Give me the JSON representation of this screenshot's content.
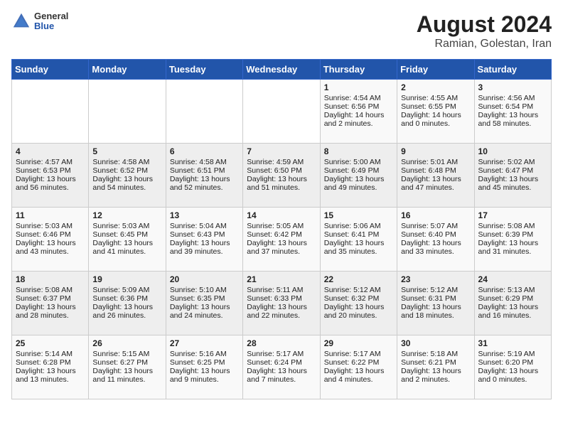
{
  "logo": {
    "general": "General",
    "blue": "Blue"
  },
  "title": "August 2024",
  "subtitle": "Ramian, Golestan, Iran",
  "days_of_week": [
    "Sunday",
    "Monday",
    "Tuesday",
    "Wednesday",
    "Thursday",
    "Friday",
    "Saturday"
  ],
  "weeks": [
    [
      {
        "day": "",
        "info": ""
      },
      {
        "day": "",
        "info": ""
      },
      {
        "day": "",
        "info": ""
      },
      {
        "day": "",
        "info": ""
      },
      {
        "day": "1",
        "info": "Sunrise: 4:54 AM\nSunset: 6:56 PM\nDaylight: 14 hours\nand 2 minutes."
      },
      {
        "day": "2",
        "info": "Sunrise: 4:55 AM\nSunset: 6:55 PM\nDaylight: 14 hours\nand 0 minutes."
      },
      {
        "day": "3",
        "info": "Sunrise: 4:56 AM\nSunset: 6:54 PM\nDaylight: 13 hours\nand 58 minutes."
      }
    ],
    [
      {
        "day": "4",
        "info": "Sunrise: 4:57 AM\nSunset: 6:53 PM\nDaylight: 13 hours\nand 56 minutes."
      },
      {
        "day": "5",
        "info": "Sunrise: 4:58 AM\nSunset: 6:52 PM\nDaylight: 13 hours\nand 54 minutes."
      },
      {
        "day": "6",
        "info": "Sunrise: 4:58 AM\nSunset: 6:51 PM\nDaylight: 13 hours\nand 52 minutes."
      },
      {
        "day": "7",
        "info": "Sunrise: 4:59 AM\nSunset: 6:50 PM\nDaylight: 13 hours\nand 51 minutes."
      },
      {
        "day": "8",
        "info": "Sunrise: 5:00 AM\nSunset: 6:49 PM\nDaylight: 13 hours\nand 49 minutes."
      },
      {
        "day": "9",
        "info": "Sunrise: 5:01 AM\nSunset: 6:48 PM\nDaylight: 13 hours\nand 47 minutes."
      },
      {
        "day": "10",
        "info": "Sunrise: 5:02 AM\nSunset: 6:47 PM\nDaylight: 13 hours\nand 45 minutes."
      }
    ],
    [
      {
        "day": "11",
        "info": "Sunrise: 5:03 AM\nSunset: 6:46 PM\nDaylight: 13 hours\nand 43 minutes."
      },
      {
        "day": "12",
        "info": "Sunrise: 5:03 AM\nSunset: 6:45 PM\nDaylight: 13 hours\nand 41 minutes."
      },
      {
        "day": "13",
        "info": "Sunrise: 5:04 AM\nSunset: 6:43 PM\nDaylight: 13 hours\nand 39 minutes."
      },
      {
        "day": "14",
        "info": "Sunrise: 5:05 AM\nSunset: 6:42 PM\nDaylight: 13 hours\nand 37 minutes."
      },
      {
        "day": "15",
        "info": "Sunrise: 5:06 AM\nSunset: 6:41 PM\nDaylight: 13 hours\nand 35 minutes."
      },
      {
        "day": "16",
        "info": "Sunrise: 5:07 AM\nSunset: 6:40 PM\nDaylight: 13 hours\nand 33 minutes."
      },
      {
        "day": "17",
        "info": "Sunrise: 5:08 AM\nSunset: 6:39 PM\nDaylight: 13 hours\nand 31 minutes."
      }
    ],
    [
      {
        "day": "18",
        "info": "Sunrise: 5:08 AM\nSunset: 6:37 PM\nDaylight: 13 hours\nand 28 minutes."
      },
      {
        "day": "19",
        "info": "Sunrise: 5:09 AM\nSunset: 6:36 PM\nDaylight: 13 hours\nand 26 minutes."
      },
      {
        "day": "20",
        "info": "Sunrise: 5:10 AM\nSunset: 6:35 PM\nDaylight: 13 hours\nand 24 minutes."
      },
      {
        "day": "21",
        "info": "Sunrise: 5:11 AM\nSunset: 6:33 PM\nDaylight: 13 hours\nand 22 minutes."
      },
      {
        "day": "22",
        "info": "Sunrise: 5:12 AM\nSunset: 6:32 PM\nDaylight: 13 hours\nand 20 minutes."
      },
      {
        "day": "23",
        "info": "Sunrise: 5:12 AM\nSunset: 6:31 PM\nDaylight: 13 hours\nand 18 minutes."
      },
      {
        "day": "24",
        "info": "Sunrise: 5:13 AM\nSunset: 6:29 PM\nDaylight: 13 hours\nand 16 minutes."
      }
    ],
    [
      {
        "day": "25",
        "info": "Sunrise: 5:14 AM\nSunset: 6:28 PM\nDaylight: 13 hours\nand 13 minutes."
      },
      {
        "day": "26",
        "info": "Sunrise: 5:15 AM\nSunset: 6:27 PM\nDaylight: 13 hours\nand 11 minutes."
      },
      {
        "day": "27",
        "info": "Sunrise: 5:16 AM\nSunset: 6:25 PM\nDaylight: 13 hours\nand 9 minutes."
      },
      {
        "day": "28",
        "info": "Sunrise: 5:17 AM\nSunset: 6:24 PM\nDaylight: 13 hours\nand 7 minutes."
      },
      {
        "day": "29",
        "info": "Sunrise: 5:17 AM\nSunset: 6:22 PM\nDaylight: 13 hours\nand 4 minutes."
      },
      {
        "day": "30",
        "info": "Sunrise: 5:18 AM\nSunset: 6:21 PM\nDaylight: 13 hours\nand 2 minutes."
      },
      {
        "day": "31",
        "info": "Sunrise: 5:19 AM\nSunset: 6:20 PM\nDaylight: 13 hours\nand 0 minutes."
      }
    ]
  ]
}
